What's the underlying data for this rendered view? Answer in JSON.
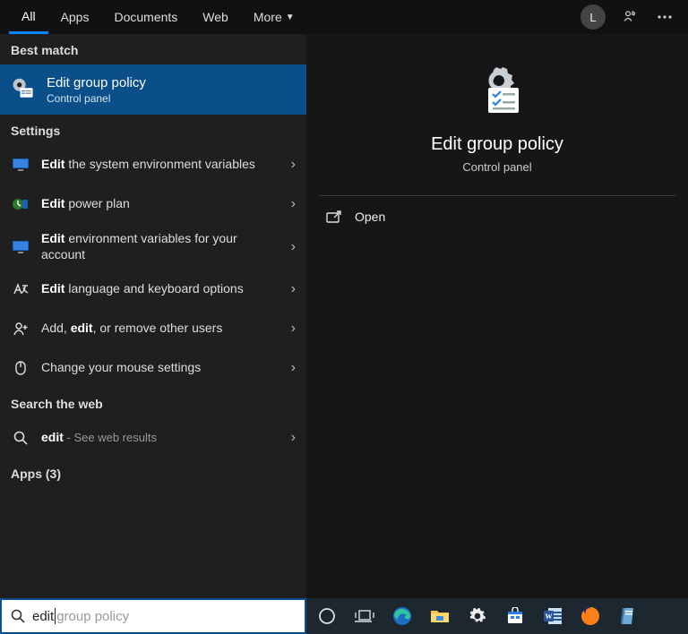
{
  "topbar": {
    "tabs": [
      "All",
      "Apps",
      "Documents",
      "Web",
      "More"
    ],
    "avatar_initial": "L"
  },
  "left": {
    "best_match_header": "Best match",
    "best_match": {
      "title": "Edit group policy",
      "subtitle": "Control panel"
    },
    "settings_header": "Settings",
    "settings_items": [
      {
        "bold": "Edit",
        "rest": " the system environment variables"
      },
      {
        "bold": "Edit",
        "rest": " power plan"
      },
      {
        "bold": "Edit",
        "rest": " environment variables for your account"
      },
      {
        "bold": "Edit",
        "rest": " language and keyboard options"
      },
      {
        "prefix": "Add, ",
        "bold": "edit",
        "rest": ", or remove other users"
      },
      {
        "prefix": "",
        "bold": "",
        "rest": "Change your mouse settings"
      }
    ],
    "web_header": "Search the web",
    "web_item": {
      "bold": "edit",
      "sep": " - ",
      "sub": "See web results"
    },
    "apps_header": "Apps (3)"
  },
  "right": {
    "title": "Edit group policy",
    "subtitle": "Control panel",
    "actions": [
      "Open"
    ]
  },
  "search": {
    "typed": "edit",
    "hint": " group policy"
  }
}
